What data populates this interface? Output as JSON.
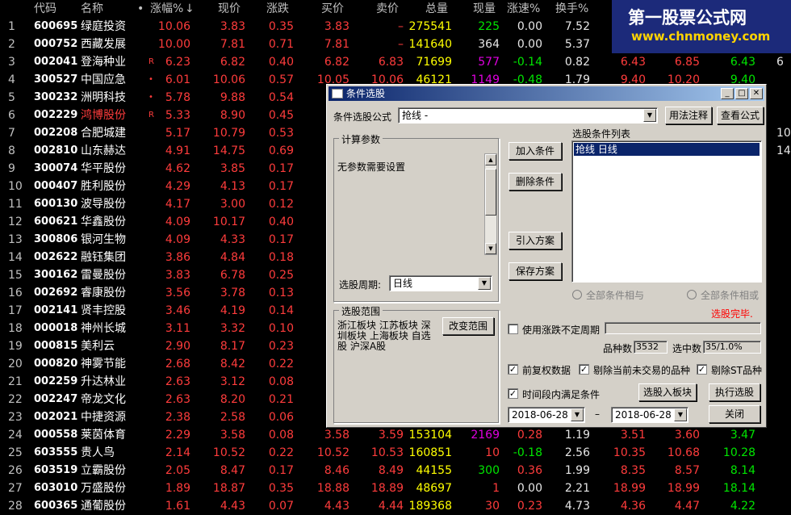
{
  "headers": {
    "code": "代码",
    "name": "名称",
    "dot": "•",
    "pct": "涨幅%",
    "pct_arrow": "↓",
    "price": "现价",
    "change": "涨跌",
    "bid": "买价",
    "ask": "卖价",
    "volume": "总量",
    "current": "现量",
    "speed": "涨速%",
    "turnover": "换手%"
  },
  "rows": [
    {
      "i": "1",
      "code": "600695",
      "name": "绿庭投资",
      "flag": "",
      "pct": "10.06",
      "price": "3.83",
      "chg": "0.35",
      "bid": "3.83",
      "ask": "–",
      "vol": "275541",
      "cur": "225",
      "spd": "0.00",
      "turn": "7.52",
      "o": "",
      "h": "",
      "l": "",
      "cc": "red",
      "curc": "grn"
    },
    {
      "i": "2",
      "code": "000752",
      "name": "西藏发展",
      "flag": "",
      "pct": "10.00",
      "price": "7.81",
      "chg": "0.71",
      "bid": "7.81",
      "ask": "–",
      "vol": "141640",
      "cur": "364",
      "spd": "0.00",
      "turn": "5.37",
      "o": "",
      "h": "",
      "l": "",
      "cc": "red",
      "curc": "wht"
    },
    {
      "i": "3",
      "code": "002041",
      "name": "登海种业",
      "flag": "R",
      "pct": "6.23",
      "price": "6.82",
      "chg": "0.40",
      "bid": "6.82",
      "ask": "6.83",
      "vol": "71699",
      "cur": "577",
      "spd": "-0.14",
      "turn": "0.82",
      "o": "6.43",
      "h": "6.85",
      "l": "6.43",
      "cc": "red",
      "curc": "mag"
    },
    {
      "i": "4",
      "code": "300527",
      "name": "中国应急",
      "flag": "•",
      "pct": "6.01",
      "price": "10.06",
      "chg": "0.57",
      "bid": "10.05",
      "ask": "10.06",
      "vol": "46121",
      "cur": "1149",
      "spd": "-0.48",
      "turn": "1.79",
      "o": "9.40",
      "h": "10.20",
      "l": "9.40",
      "cc": "red",
      "curc": "mag"
    },
    {
      "i": "5",
      "code": "300232",
      "name": "洲明科技",
      "flag": "•",
      "pct": "5.78",
      "price": "9.88",
      "chg": "0.54",
      "bid": "",
      "ask": "",
      "vol": "",
      "cur": "",
      "spd": "",
      "turn": "",
      "o": "",
      "h": "",
      "l": "",
      "cc": "red",
      "curc": "wht"
    },
    {
      "i": "6",
      "code": "002229",
      "name": "鸿博股份",
      "flag": "R",
      "pct": "5.33",
      "price": "8.90",
      "chg": "0.45",
      "bid": "",
      "ask": "",
      "vol": "",
      "cur": "",
      "spd": "",
      "turn": "",
      "o": "",
      "h": "",
      "l": "",
      "cc": "red",
      "curc": "wht",
      "namec": "red"
    },
    {
      "i": "7",
      "code": "002208",
      "name": "合肥城建",
      "flag": "",
      "pct": "5.17",
      "price": "10.79",
      "chg": "0.53",
      "bid": "",
      "ask": "",
      "vol": "",
      "cur": "",
      "spd": "",
      "turn": "",
      "o": "",
      "h": "",
      "l": "",
      "cc": "red",
      "curc": "wht"
    },
    {
      "i": "8",
      "code": "002810",
      "name": "山东赫达",
      "flag": "",
      "pct": "4.91",
      "price": "14.75",
      "chg": "0.69",
      "bid": "",
      "ask": "",
      "vol": "",
      "cur": "",
      "spd": "",
      "turn": "",
      "o": "",
      "h": "",
      "l": "",
      "cc": "red",
      "curc": "wht"
    },
    {
      "i": "9",
      "code": "300074",
      "name": "华平股份",
      "flag": "",
      "pct": "4.62",
      "price": "3.85",
      "chg": "0.17",
      "bid": "",
      "ask": "",
      "vol": "",
      "cur": "",
      "spd": "",
      "turn": "",
      "o": "",
      "h": "",
      "l": "",
      "cc": "red",
      "curc": "wht"
    },
    {
      "i": "10",
      "code": "000407",
      "name": "胜利股份",
      "flag": "",
      "pct": "4.29",
      "price": "4.13",
      "chg": "0.17",
      "bid": "",
      "ask": "",
      "vol": "",
      "cur": "",
      "spd": "",
      "turn": "",
      "o": "",
      "h": "",
      "l": "",
      "cc": "red",
      "curc": "wht"
    },
    {
      "i": "11",
      "code": "600130",
      "name": "波导股份",
      "flag": "",
      "pct": "4.17",
      "price": "3.00",
      "chg": "0.12",
      "bid": "",
      "ask": "",
      "vol": "",
      "cur": "",
      "spd": "",
      "turn": "",
      "o": "",
      "h": "",
      "l": "",
      "cc": "red",
      "curc": "wht"
    },
    {
      "i": "12",
      "code": "600621",
      "name": "华鑫股份",
      "flag": "",
      "pct": "4.09",
      "price": "10.17",
      "chg": "0.40",
      "bid": "",
      "ask": "",
      "vol": "",
      "cur": "",
      "spd": "",
      "turn": "",
      "o": "",
      "h": "",
      "l": "",
      "cc": "red",
      "curc": "wht"
    },
    {
      "i": "13",
      "code": "300806",
      "name": "银河生物",
      "flag": "",
      "pct": "4.09",
      "price": "4.33",
      "chg": "0.17",
      "bid": "",
      "ask": "",
      "vol": "",
      "cur": "",
      "spd": "",
      "turn": "",
      "o": "",
      "h": "",
      "l": "",
      "cc": "red",
      "curc": "wht"
    },
    {
      "i": "14",
      "code": "002622",
      "name": "融钰集团",
      "flag": "",
      "pct": "3.86",
      "price": "4.84",
      "chg": "0.18",
      "bid": "",
      "ask": "",
      "vol": "",
      "cur": "",
      "spd": "",
      "turn": "",
      "o": "",
      "h": "",
      "l": "",
      "cc": "red",
      "curc": "wht"
    },
    {
      "i": "15",
      "code": "300162",
      "name": "雷曼股份",
      "flag": "",
      "pct": "3.83",
      "price": "6.78",
      "chg": "0.25",
      "bid": "",
      "ask": "",
      "vol": "",
      "cur": "",
      "spd": "",
      "turn": "",
      "o": "",
      "h": "",
      "l": "",
      "cc": "red",
      "curc": "wht"
    },
    {
      "i": "16",
      "code": "002692",
      "name": "睿康股份",
      "flag": "",
      "pct": "3.56",
      "price": "3.78",
      "chg": "0.13",
      "bid": "",
      "ask": "",
      "vol": "",
      "cur": "",
      "spd": "",
      "turn": "",
      "o": "",
      "h": "",
      "l": "",
      "cc": "red",
      "curc": "wht"
    },
    {
      "i": "17",
      "code": "002141",
      "name": "贤丰控股",
      "flag": "",
      "pct": "3.46",
      "price": "4.19",
      "chg": "0.14",
      "bid": "",
      "ask": "",
      "vol": "",
      "cur": "",
      "spd": "",
      "turn": "",
      "o": "",
      "h": "",
      "l": "",
      "cc": "red",
      "curc": "wht"
    },
    {
      "i": "18",
      "code": "000018",
      "name": "神州长城",
      "flag": "",
      "pct": "3.11",
      "price": "3.32",
      "chg": "0.10",
      "bid": "",
      "ask": "",
      "vol": "",
      "cur": "",
      "spd": "",
      "turn": "",
      "o": "",
      "h": "",
      "l": "",
      "cc": "red",
      "curc": "wht"
    },
    {
      "i": "19",
      "code": "000815",
      "name": "美利云",
      "flag": "",
      "pct": "2.90",
      "price": "8.17",
      "chg": "0.23",
      "bid": "",
      "ask": "",
      "vol": "",
      "cur": "",
      "spd": "",
      "turn": "",
      "o": "",
      "h": "",
      "l": "",
      "cc": "red",
      "curc": "wht"
    },
    {
      "i": "20",
      "code": "000820",
      "name": "神雾节能",
      "flag": "",
      "pct": "2.68",
      "price": "8.42",
      "chg": "0.22",
      "bid": "",
      "ask": "",
      "vol": "",
      "cur": "",
      "spd": "",
      "turn": "",
      "o": "",
      "h": "",
      "l": "",
      "cc": "red",
      "curc": "wht"
    },
    {
      "i": "21",
      "code": "002259",
      "name": "升达林业",
      "flag": "",
      "pct": "2.63",
      "price": "3.12",
      "chg": "0.08",
      "bid": "",
      "ask": "",
      "vol": "",
      "cur": "",
      "spd": "",
      "turn": "",
      "o": "",
      "h": "",
      "l": "",
      "cc": "red",
      "curc": "wht"
    },
    {
      "i": "22",
      "code": "002247",
      "name": "帝龙文化",
      "flag": "",
      "pct": "2.63",
      "price": "8.20",
      "chg": "0.21",
      "bid": "",
      "ask": "",
      "vol": "",
      "cur": "",
      "spd": "",
      "turn": "",
      "o": "",
      "h": "",
      "l": "",
      "cc": "red",
      "curc": "wht"
    },
    {
      "i": "23",
      "code": "002021",
      "name": "中捷资源",
      "flag": "",
      "pct": "2.38",
      "price": "2.58",
      "chg": "0.06",
      "bid": "",
      "ask": "",
      "vol": "",
      "cur": "",
      "spd": "",
      "turn": "",
      "o": "",
      "h": "",
      "l": "",
      "cc": "red",
      "curc": "wht"
    },
    {
      "i": "24",
      "code": "000558",
      "name": "莱茵体育",
      "flag": "",
      "pct": "2.29",
      "price": "3.58",
      "chg": "0.08",
      "bid": "3.58",
      "ask": "3.59",
      "vol": "153104",
      "cur": "2169",
      "spd": "0.28",
      "turn": "1.19",
      "o": "3.51",
      "h": "3.60",
      "l": "3.47",
      "cc": "red",
      "curc": "mag"
    },
    {
      "i": "25",
      "code": "603555",
      "name": "贵人鸟",
      "flag": "",
      "pct": "2.14",
      "price": "10.52",
      "chg": "0.22",
      "bid": "10.52",
      "ask": "10.53",
      "vol": "160851",
      "cur": "10",
      "spd": "-0.18",
      "turn": "2.56",
      "o": "10.35",
      "h": "10.68",
      "l": "10.28",
      "cc": "red",
      "curc": "red"
    },
    {
      "i": "26",
      "code": "603519",
      "name": "立霸股份",
      "flag": "",
      "pct": "2.05",
      "price": "8.47",
      "chg": "0.17",
      "bid": "8.46",
      "ask": "8.49",
      "vol": "44155",
      "cur": "300",
      "spd": "0.36",
      "turn": "1.99",
      "o": "8.35",
      "h": "8.57",
      "l": "8.14",
      "cc": "red",
      "curc": "grn"
    },
    {
      "i": "27",
      "code": "603010",
      "name": "万盛股份",
      "flag": "",
      "pct": "1.89",
      "price": "18.87",
      "chg": "0.35",
      "bid": "18.88",
      "ask": "18.89",
      "vol": "48697",
      "cur": "1",
      "spd": "0.00",
      "turn": "2.21",
      "o": "18.99",
      "h": "18.99",
      "l": "18.14",
      "cc": "red",
      "curc": "red"
    },
    {
      "i": "28",
      "code": "600365",
      "name": "通葡股份",
      "flag": "",
      "pct": "1.61",
      "price": "4.43",
      "chg": "0.07",
      "bid": "4.43",
      "ask": "4.44",
      "vol": "189368",
      "cur": "30",
      "spd": "0.23",
      "turn": "4.73",
      "o": "4.36",
      "h": "4.47",
      "l": "4.22",
      "cc": "red",
      "curc": "red"
    }
  ],
  "edge_values": [
    "",
    "",
    "6",
    "",
    "",
    "",
    "10",
    "14",
    "",
    "",
    "",
    "",
    "",
    "",
    "",
    "",
    "",
    "",
    "",
    "",
    "",
    "",
    "",
    "",
    "",
    "",
    "",
    ""
  ],
  "watermark": {
    "line1": "第一股票公式网",
    "line2": "www.chnmoney.com"
  },
  "dialog": {
    "title": "条件选股",
    "formula_label": "条件选股公式",
    "formula_value": "抢线                    -",
    "btn_usage": "用法注释",
    "btn_view": "查看公式",
    "params_group": "计算参数",
    "params_text": "无参数需要设置",
    "period_label": "选股周期:",
    "period_value": "日线",
    "btn_add": "加入条件",
    "btn_delete": "删除条件",
    "btn_import": "引入方案",
    "btn_save": "保存方案",
    "list_label": "选股条件列表",
    "list_item": "抢线   日线",
    "radio_and": "全部条件相与",
    "radio_or": "全部条件相或",
    "status": "选股完毕.",
    "range_group": "选股范围",
    "range_text": "浙江板块 江苏板块 深圳板块 上海板块 自选股 沪深A股",
    "btn_change_range": "改变范围",
    "chk_indeterminate": "使用涨跌不定周期",
    "count_label": "品种数",
    "count_value": "3532",
    "selected_label": "选中数",
    "selected_value": "35/1.0%",
    "chk_adjusted": "前复权数据",
    "chk_exclude_untraded": "剔除当前未交易的品种",
    "chk_exclude_st": "剔除ST品种",
    "chk_period_all": "时间段内满足条件",
    "btn_to_block": "选股入板块",
    "btn_run": "执行选股",
    "date_from": "2018-06-28",
    "date_sep": "–",
    "date_to": "2018-06-28",
    "btn_close": "关闭",
    "colors": {
      "title_bar": "#0a246a",
      "status": "#ff0000"
    }
  },
  "colors": {
    "up": "#ff3c3c",
    "down": "#00e600",
    "flat": "#e6e6e6",
    "volume": "#ffff00",
    "current": "#e000e0"
  }
}
